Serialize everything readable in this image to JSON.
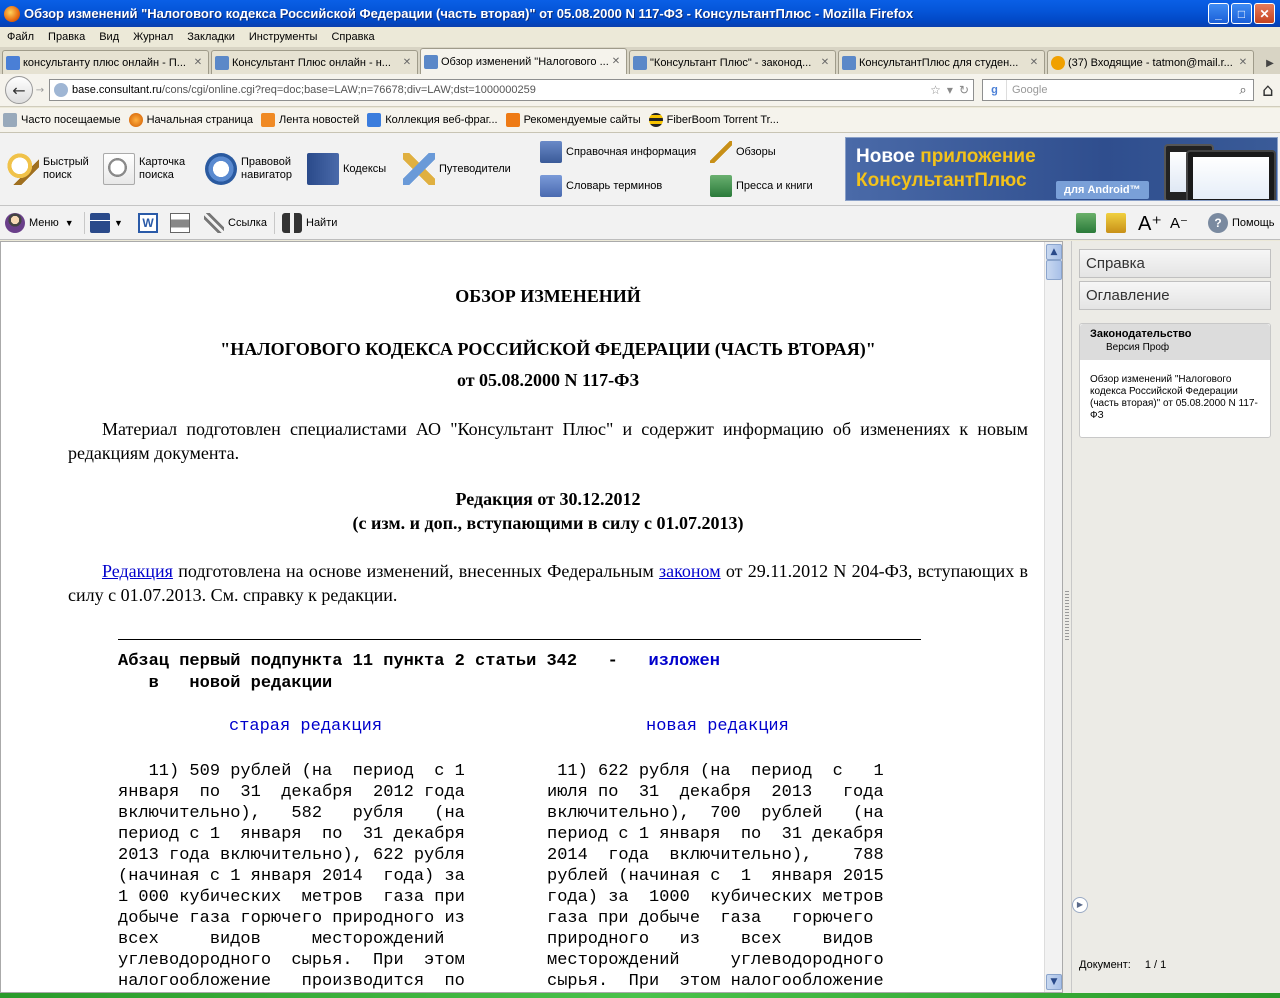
{
  "window": {
    "title": "Обзор изменений \"Налогового кодекса Российской Федерации (часть вторая)\" от 05.08.2000 N 117-ФЗ - КонсультантПлюс - Mozilla Firefox",
    "controls": [
      "_",
      "□",
      "✕"
    ]
  },
  "menu": [
    "Файл",
    "Правка",
    "Вид",
    "Журнал",
    "Закладки",
    "Инструменты",
    "Справка"
  ],
  "tabs": [
    {
      "label": "консультанту плюс онлайн - П...",
      "icon": "google-icon",
      "active": false
    },
    {
      "label": "Консультант Плюс онлайн - н...",
      "icon": "consultant-icon",
      "active": false
    },
    {
      "label": "Обзор изменений \"Налогового ...",
      "icon": "consultant-icon",
      "active": true
    },
    {
      "label": "\"Консультант Плюс\" - законод...",
      "icon": "consultant-icon",
      "active": false
    },
    {
      "label": "КонсультантПлюс для студен...",
      "icon": "consultant-icon",
      "active": false
    },
    {
      "label": "(37) Входящие - tatmon@mail.r...",
      "icon": "mail-icon",
      "active": false
    }
  ],
  "nav": {
    "url_host": "base.consultant.ru",
    "url_path": "/cons/cgi/online.cgi?req=doc;base=LAW;n=76678;div=LAW;dst=1000000259",
    "search_engine": "g",
    "search_placeholder": "Google"
  },
  "bookmarks": [
    {
      "label": "Часто посещаемые",
      "icon": "gear-icon"
    },
    {
      "label": "Начальная страница",
      "icon": "firefox-icon"
    },
    {
      "label": "Лента новостей",
      "icon": "rss-icon"
    },
    {
      "label": "Коллекция веб-фраг...",
      "icon": "ie-icon"
    },
    {
      "label": "Рекомендуемые сайты",
      "icon": "recommended-icon"
    },
    {
      "label": "FiberBoom Torrent Tr...",
      "icon": "bee-icon"
    }
  ],
  "ctoolbar": {
    "quick_search": "Быстрый\nпоиск",
    "search_card": "Карточка\nпоиска",
    "legal_nav": "Правовой\nнавигатор",
    "codexes": "Кодексы",
    "guides": "Путеводители",
    "reference": "Справочная информация",
    "reviews": "Обзоры",
    "dictionary": "Словарь терминов",
    "press": "Пресса и книги"
  },
  "banner": {
    "line1_white": "Новое",
    "line1_yellow": "приложение",
    "line2": "КонсультантПлюс",
    "badge": "для Android™"
  },
  "toolbar2": {
    "menu": "Меню",
    "link": "Ссылка",
    "find": "Найти",
    "help": "Помощь",
    "word": "W"
  },
  "document": {
    "title1": "ОБЗОР ИЗМЕНЕНИЙ",
    "title2": "\"НАЛОГОВОГО КОДЕКСА РОССИЙСКОЙ ФЕДЕРАЦИИ (ЧАСТЬ ВТОРАЯ)\"",
    "title3": "от 05.08.2000 N 117-ФЗ",
    "intro": "Материал подготовлен специалистами АО \"Консультант Плюс\" и содержит информацию об изменениях к новым редакциям документа.",
    "edition1": "Редакция от 30.12.2012",
    "edition2": "(с изм. и доп., вступающими в силу с 01.07.2013)",
    "p2_link1": "Редакция",
    "p2_text1": " подготовлена на основе изменений, внесенных Федеральным ",
    "p2_link2": "законом",
    "p2_text2": " от 29.11.2012 N 204-ФЗ, вступающих в силу с 01.07.2013. См. справку к редакции.",
    "abz_text1": "Абзац первый подпункта 11 пункта 2 статьи 342   -   ",
    "abz_link": "изложен",
    "abz_text2": "   в   новой редакции",
    "old_head": "старая редакция",
    "new_head": "новая редакция",
    "old_text": "   11) 509 рублей (на  период  с 1\nянваря  по  31  декабря  2012 года\nвключительно),   582   рубля   (на\nпериод с 1  января  по  31 декабря\n2013 года включительно), 622 рубля\n(начиная с 1 января 2014  года) за\n1 000 кубических  метров  газа при\nдобыче газа горючего природного из\nвсех     видов     месторождений\nуглеводородного  сырья.  При  этом\nналогообложение   производится  по",
    "new_text": " 11) 622 рубля (на  период  с   1\nиюля по  31  декабря  2013   года\nвключительно),  700  рублей   (на\nпериод с 1 января  по  31 декабря\n2014  года  включительно),    788\nрублей (начиная с  1  января 2015\nгода) за  1000  кубических метров\nгаза при добыче  газа   горючего\nприродного   из    всех    видов\nместорождений     углеводородного\nсырья.  При  этом налогообложение"
  },
  "sidepanel": {
    "help_btn": "Справка",
    "toc_btn": "Оглавление",
    "box_title": "Законодательство",
    "box_subtitle": "Версия Проф",
    "box_text": "Обзор изменений \"Налогового кодекса Российской Федерации (часть вторая)\" от 05.08.2000 N 117-ФЗ",
    "doc_label": "Документ:",
    "doc_count": "1 / 1"
  }
}
